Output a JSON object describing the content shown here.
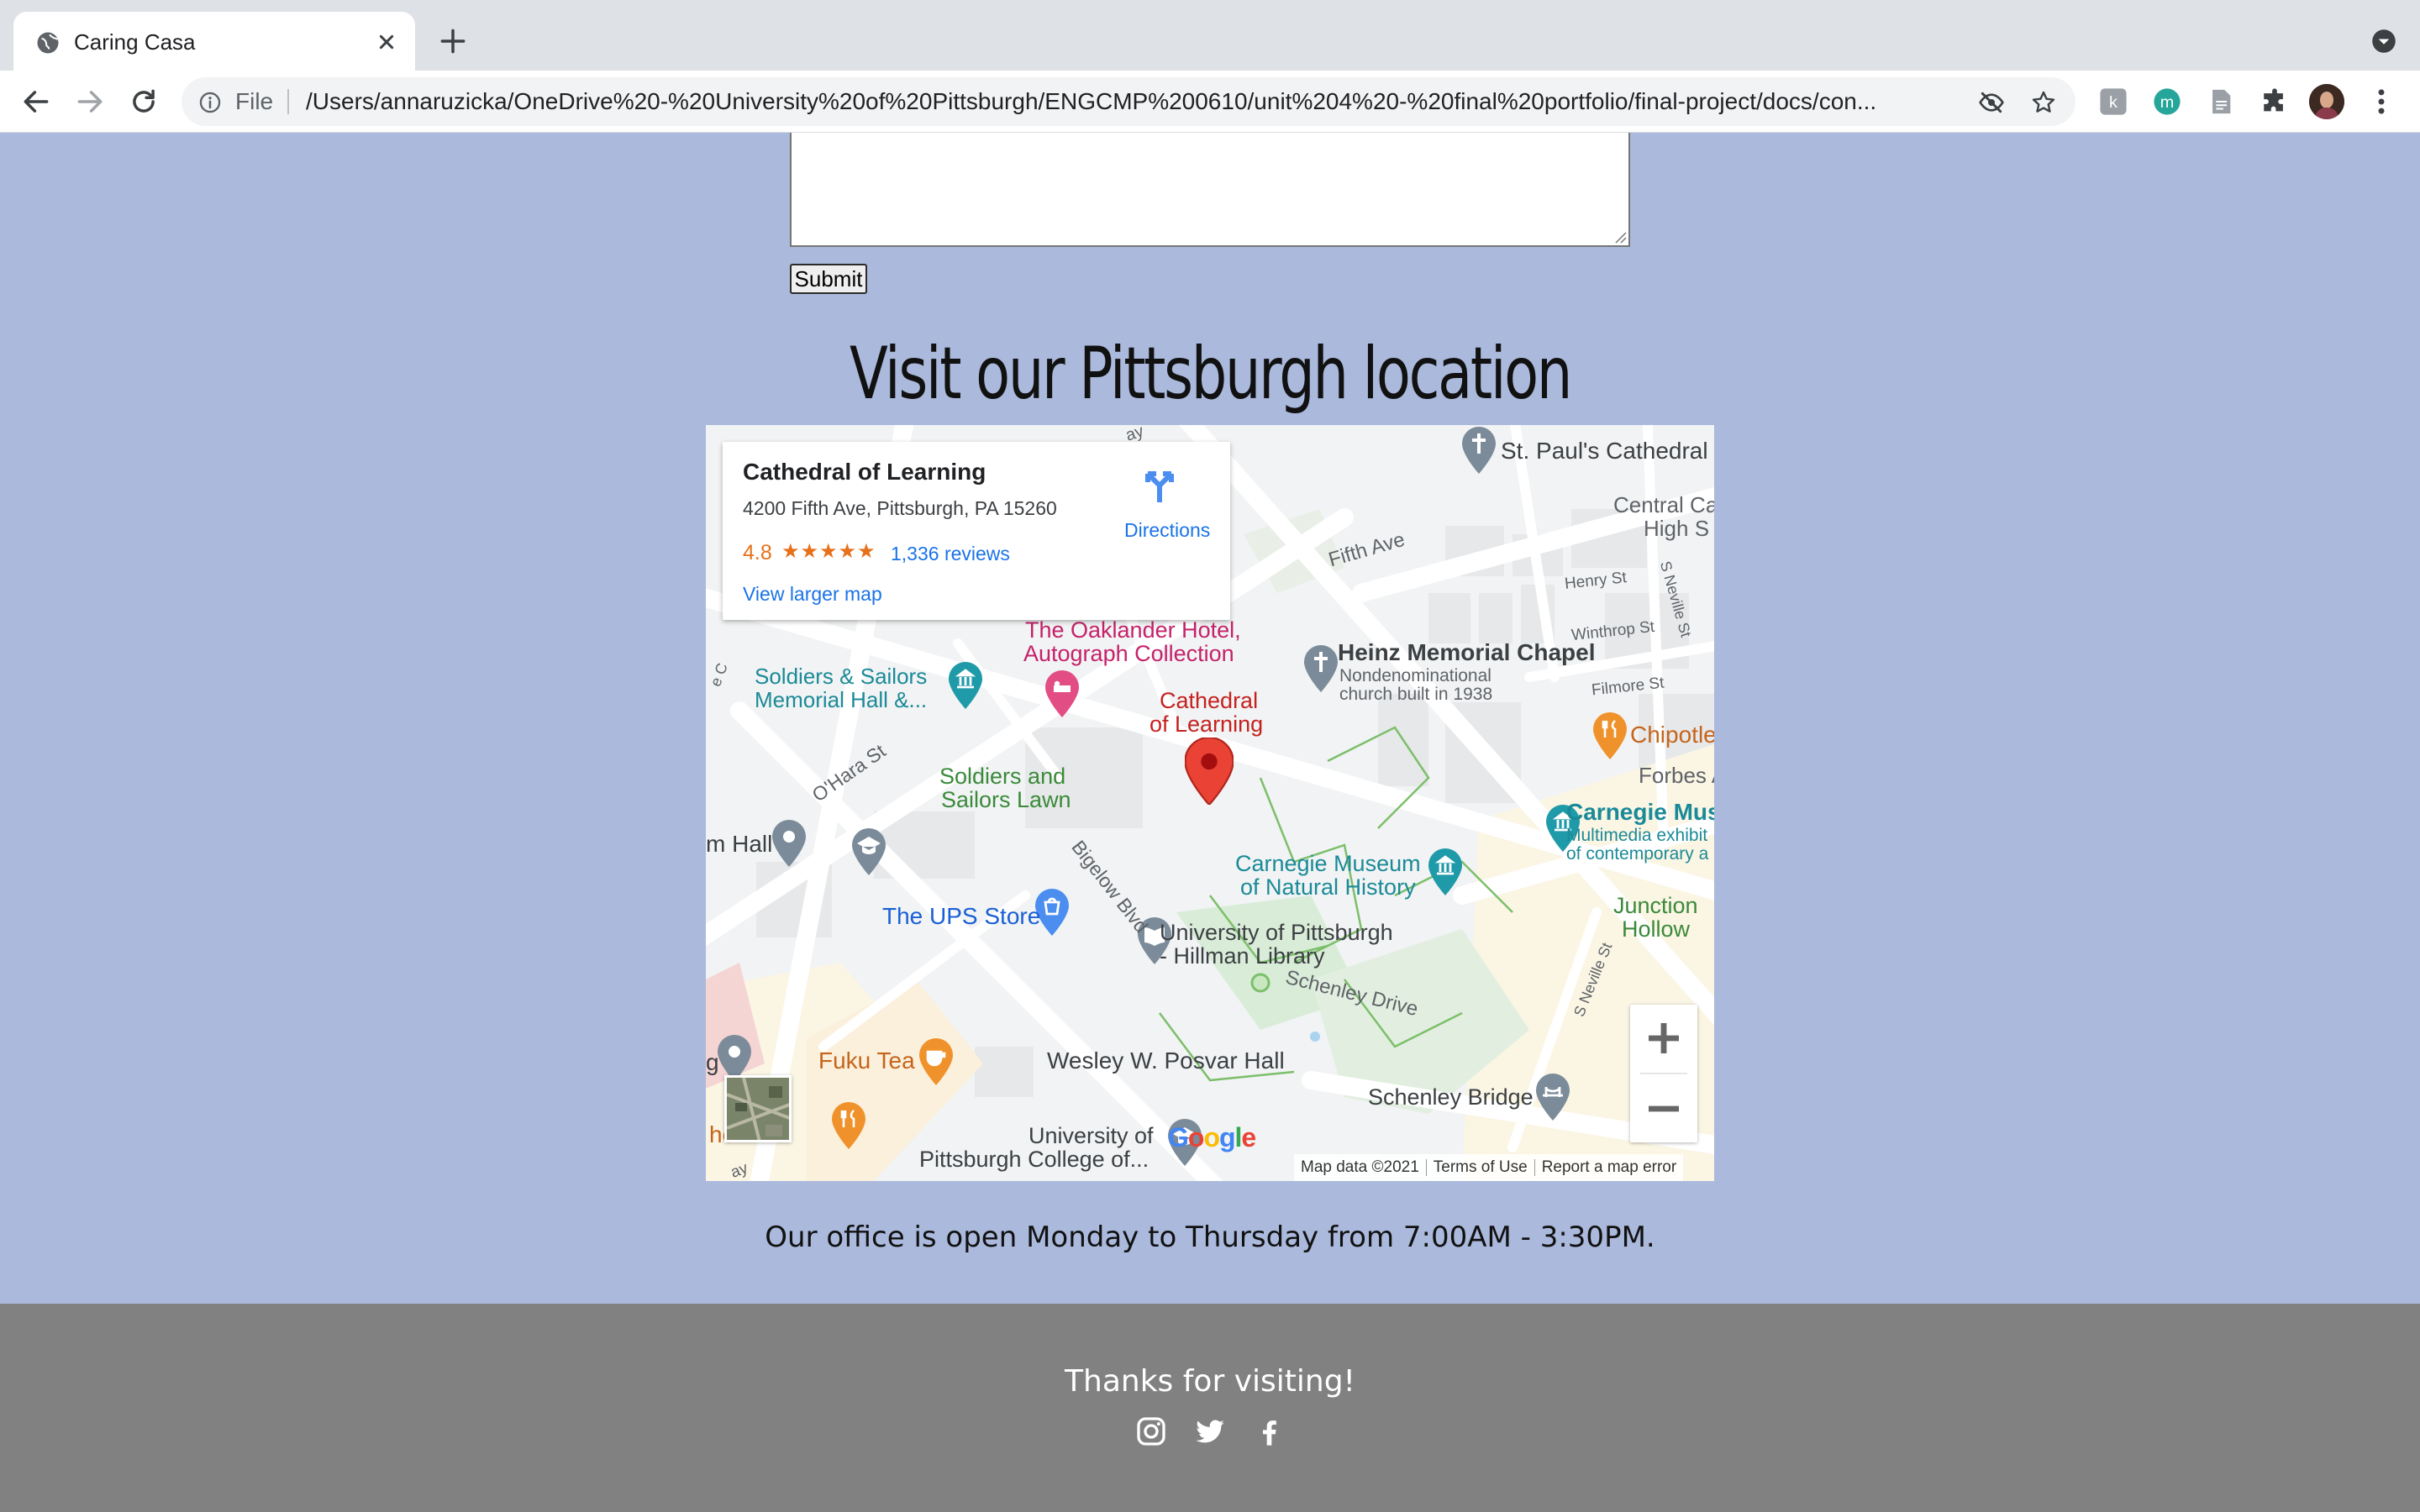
{
  "browser": {
    "tab_title": "Caring Casa",
    "file_label": "File",
    "url": "/Users/annaruzicka/OneDrive%20-%20University%20of%20Pittsburgh/ENGCMP%200610/unit%204%20-%20final%20portfolio/final-project/docs/con..."
  },
  "form": {
    "submit_label": "Submit"
  },
  "page": {
    "heading": "Visit our Pittsburgh location",
    "hours": "Our office is open Monday to Thursday from 7:00AM - 3:30PM."
  },
  "map": {
    "place_name": "Cathedral of Learning",
    "address": "4200 Fifth Ave, Pittsburgh, PA 15260",
    "rating": "4.8",
    "stars": "★★★★★",
    "reviews": "1,336 reviews",
    "larger_map": "View larger map",
    "directions": "Directions",
    "zoom_in": "+",
    "zoom_out": "−",
    "google": [
      "G",
      "o",
      "o",
      "g",
      "l",
      "e"
    ],
    "attribution": {
      "map_data": "Map data ©2021",
      "terms": "Terms of Use",
      "report": "Report a map error"
    },
    "labels": {
      "st_pauls": "St. Paul's Cathedral",
      "central_high_1": "Central Ca",
      "central_high_2": "High S",
      "fifth_ave": "Fifth Ave",
      "henry_st": "Henry St",
      "winthrop_st": "Winthrop St",
      "fillmore_st": "Filmore St",
      "forbes_av": "Forbes Av",
      "s_neville_top": "S Neville St",
      "s_neville_bottom": "S Neville St",
      "chipotle": "Chipotle",
      "oaklander_1": "The Oaklander Hotel,",
      "oaklander_2": "Autograph Collection",
      "heinz_title": "Heinz Memorial Chapel",
      "heinz_sub_1": "Nondenominational",
      "heinz_sub_2": "church built in 1938",
      "soldiers_hall_1": "Soldiers & Sailors",
      "soldiers_hall_2": "Memorial Hall &...",
      "cathedral_1": "Cathedral",
      "cathedral_2": "of Learning",
      "ohara_st": "O'Hara St",
      "soldiers_lawn_1": "Soldiers and",
      "soldiers_lawn_2": "Sailors Lawn",
      "bigelow": "Bigelow Blvd",
      "cmu_art_1": "Carnegie Muse",
      "cmu_art_2": "Multimedia exhibit",
      "cmu_art_3": "of contemporary a",
      "nat_history_1": "Carnegie Museum",
      "nat_history_2": "of Natural History",
      "junction_1": "Junction",
      "junction_2": "Hollow",
      "m_hall": "m Hall",
      "ups": "The UPS Store",
      "hillman_1": "University of Pittsburgh",
      "hillman_2": "- Hillman Library",
      "schenley_dr": "Schenley Drive",
      "fuku": "Fuku Tea",
      "posvar": "Wesley W. Posvar Hall",
      "schenley_bridge": "Schenley Bridge",
      "upmc_1": "University of",
      "upmc_2": "Pittsburgh College of...",
      "hen": "hen",
      "g_edge": "g",
      "ay": "ay",
      "ray": "ay",
      "e_c": "e C"
    }
  },
  "footer": {
    "thanks": "Thanks for visiting!"
  },
  "colors": {
    "page_bg": "#aab9dc",
    "footer_bg": "#818181",
    "map_pin": "#ea4335",
    "link_blue": "#1a73e8",
    "rating_orange": "#e7711b"
  }
}
